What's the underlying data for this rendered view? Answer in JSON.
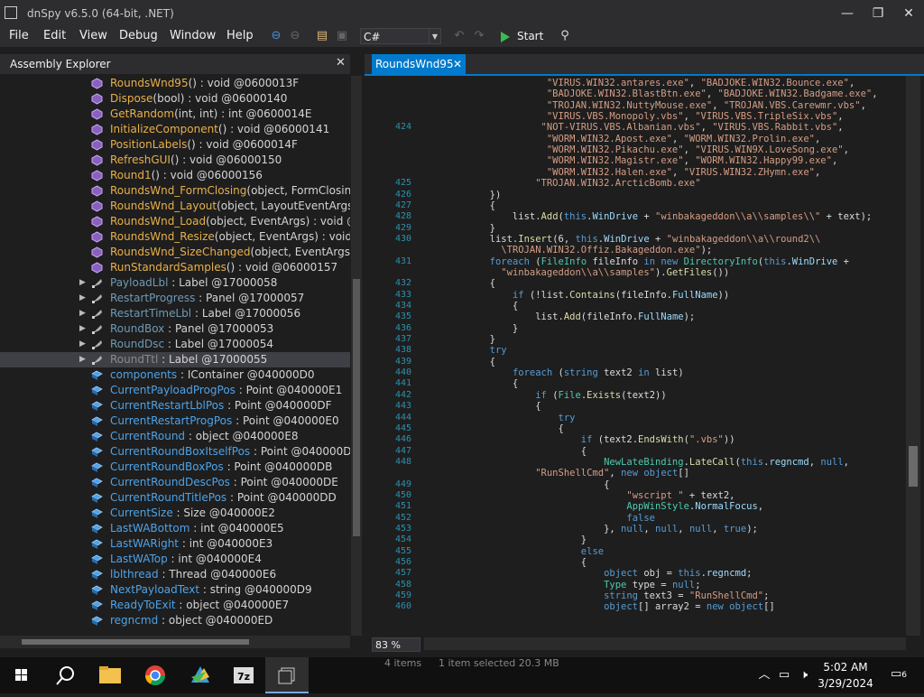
{
  "window": {
    "title": "dnSpy v6.5.0 (64-bit, .NET)",
    "minimize": "—",
    "maximize": "❐",
    "close": "✕"
  },
  "menu": [
    "File",
    "Edit",
    "View",
    "Debug",
    "Window",
    "Help"
  ],
  "toolbar": {
    "language": "C#",
    "start_label": "Start"
  },
  "assembly_explorer": {
    "title": "Assembly Explorer",
    "items": [
      {
        "name": "RoundsWnd95",
        "sig": "() : void @0600013F",
        "kind": "method"
      },
      {
        "name": "Dispose",
        "sig": "(bool) : void @06000140",
        "kind": "method"
      },
      {
        "name": "GetRandom",
        "sig": "(int, int) : int @0600014E",
        "kind": "method"
      },
      {
        "name": "InitializeComponent",
        "sig": "() : void @06000141",
        "kind": "method"
      },
      {
        "name": "PositionLabels",
        "sig": "() : void @0600014F",
        "kind": "method"
      },
      {
        "name": "RefreshGUI",
        "sig": "() : void @06000150",
        "kind": "method"
      },
      {
        "name": "Round1",
        "sig": "() : void @06000156",
        "kind": "method"
      },
      {
        "name": "RoundsWnd_FormClosing",
        "sig": "(object, FormClosingEve",
        "kind": "method"
      },
      {
        "name": "RoundsWnd_Layout",
        "sig": "(object, LayoutEventArgs) : vo",
        "kind": "method"
      },
      {
        "name": "RoundsWnd_Load",
        "sig": "(object, EventArgs) : void @0600",
        "kind": "method"
      },
      {
        "name": "RoundsWnd_Resize",
        "sig": "(object, EventArgs) : void @060",
        "kind": "method"
      },
      {
        "name": "RoundsWnd_SizeChanged",
        "sig": "(object, EventArgs) : voi",
        "kind": "method"
      },
      {
        "name": "RunStandardSamples",
        "sig": "() : void @06000157",
        "kind": "method"
      },
      {
        "name": "PayloadLbl",
        "sig": " : Label @17000058",
        "kind": "prop"
      },
      {
        "name": "RestartProgress",
        "sig": " : Panel @17000057",
        "kind": "prop"
      },
      {
        "name": "RestartTimeLbl",
        "sig": " : Label @17000056",
        "kind": "prop"
      },
      {
        "name": "RoundBox",
        "sig": " : Panel @17000053",
        "kind": "prop"
      },
      {
        "name": "RoundDsc",
        "sig": " : Label @17000054",
        "kind": "prop"
      },
      {
        "name": "RoundTtl",
        "sig": " : Label @17000055",
        "kind": "prop"
      },
      {
        "name": "components",
        "sig": " : IContainer @040000D0",
        "kind": "field"
      },
      {
        "name": "CurrentPayloadProgPos",
        "sig": " : Point @040000E1",
        "kind": "field"
      },
      {
        "name": "CurrentRestartLblPos",
        "sig": " : Point @040000DF",
        "kind": "field"
      },
      {
        "name": "CurrentRestartProgPos",
        "sig": " : Point @040000E0",
        "kind": "field"
      },
      {
        "name": "CurrentRound",
        "sig": " : object @040000E8",
        "kind": "field"
      },
      {
        "name": "CurrentRoundBoxItselfPos",
        "sig": " : Point @040000DC",
        "kind": "field"
      },
      {
        "name": "CurrentRoundBoxPos",
        "sig": " : Point @040000DB",
        "kind": "field"
      },
      {
        "name": "CurrentRoundDescPos",
        "sig": " : Point @040000DE",
        "kind": "field"
      },
      {
        "name": "CurrentRoundTitlePos",
        "sig": " : Point @040000DD",
        "kind": "field"
      },
      {
        "name": "CurrentSize",
        "sig": " : Size @040000E2",
        "kind": "field"
      },
      {
        "name": "LastWABottom",
        "sig": " : int @040000E5",
        "kind": "field"
      },
      {
        "name": "LastWARight",
        "sig": " : int @040000E3",
        "kind": "field"
      },
      {
        "name": "LastWATop",
        "sig": " : int @040000E4",
        "kind": "field"
      },
      {
        "name": "lblthread",
        "sig": " : Thread @040000E6",
        "kind": "field"
      },
      {
        "name": "NextPayloadText",
        "sig": " : string @040000D9",
        "kind": "field"
      },
      {
        "name": "ReadyToExit",
        "sig": " : object @040000E7",
        "kind": "field"
      },
      {
        "name": "regncmd",
        "sig": " : object @040000ED",
        "kind": "field"
      }
    ],
    "selected_index": 18
  },
  "editor": {
    "tab_label": "RoundsWnd95",
    "zoom": "83 %",
    "lines": [
      {
        "n": "",
        "h": "            <span class=\"s\">\"VIRUS.WIN32.antares.exe\"</span>, <span class=\"s\">\"BADJOKE.WIN32.Bounce.exe\"</span>,"
      },
      {
        "n": "",
        "h": "            <span class=\"s\">\"BADJOKE.WIN32.BlastBtn.exe\"</span>, <span class=\"s\">\"BADJOKE.WIN32.Badgame.exe\"</span>,"
      },
      {
        "n": "",
        "h": "            <span class=\"s\">\"TROJAN.WIN32.NuttyMouse.exe\"</span>, <span class=\"s\">\"TROJAN.VBS.Carewmr.vbs\"</span>,"
      },
      {
        "n": "",
        "h": "            <span class=\"s\">\"VIRUS.VBS.Monopoly.vbs\"</span>, <span class=\"s\">\"VIRUS.VBS.TripleSix.vbs\"</span>,"
      },
      {
        "n": "424",
        "h": "           <span class=\"s\">\"NOT-VIRUS.VBS.Albanian.vbs\"</span>, <span class=\"s\">\"VIRUS.VBS.Rabbit.vbs\"</span>,"
      },
      {
        "n": "",
        "h": "            <span class=\"s\">\"WORM.WIN32.Apost.exe\"</span>, <span class=\"s\">\"WORM.WIN32.Prolin.exe\"</span>,"
      },
      {
        "n": "",
        "h": "            <span class=\"s\">\"WORM.WIN32.Pikachu.exe\"</span>, <span class=\"s\">\"VIRUS.WIN9X.LoveSong.exe\"</span>,"
      },
      {
        "n": "",
        "h": "            <span class=\"s\">\"WORM.WIN32.Magistr.exe\"</span>, <span class=\"s\">\"WORM.WIN32.Happy99.exe\"</span>,"
      },
      {
        "n": "",
        "h": "            <span class=\"s\">\"WORM.WIN32.Halen.exe\"</span>, <span class=\"s\">\"VIRUS.WIN32.ZHymn.exe\"</span>,"
      },
      {
        "n": "425",
        "h": "          <span class=\"s\">\"TROJAN.WIN32.ArcticBomb.exe\"</span>"
      },
      {
        "n": "426",
        "h": "  })"
      },
      {
        "n": "427",
        "h": "  {"
      },
      {
        "n": "428",
        "h": "      list.<span class=\"m\">Add</span>(<span class=\"k\">this</span>.<span class=\"p\">WinDrive</span> + <span class=\"s\">\"winbakageddon\\\\a\\\\samples\\\\\"</span> + text);"
      },
      {
        "n": "429",
        "h": "  }"
      },
      {
        "n": "430",
        "h": "  list.<span class=\"m\">Insert</span>(6, <span class=\"k\">this</span>.<span class=\"p\">WinDrive</span> + <span class=\"s\">\"winbakageddon\\\\a\\\\round2\\\\</span>"
      },
      {
        "n": "",
        "h": "    <span class=\"s\">\\TROJAN.WIN32.Offiz.Bakageddon.exe\"</span>);"
      },
      {
        "n": "431",
        "h": "  <span class=\"k\">foreach</span> (<span class=\"t\">FileInfo</span> fileInfo <span class=\"k\">in new</span> <span class=\"t\">DirectoryInfo</span>(<span class=\"k\">this</span>.<span class=\"p\">WinDrive</span> +"
      },
      {
        "n": "",
        "h": "    <span class=\"s\">\"winbakageddon\\\\a\\\\samples\"</span>).<span class=\"m\">GetFiles</span>())"
      },
      {
        "n": "432",
        "h": "  {"
      },
      {
        "n": "433",
        "h": "      <span class=\"k\">if</span> (!list.<span class=\"m\">Contains</span>(fileInfo.<span class=\"p\">FullName</span>))"
      },
      {
        "n": "434",
        "h": "      {"
      },
      {
        "n": "435",
        "h": "          list.<span class=\"m\">Add</span>(fileInfo.<span class=\"p\">FullName</span>);"
      },
      {
        "n": "436",
        "h": "      }"
      },
      {
        "n": "437",
        "h": "  }"
      },
      {
        "n": "438",
        "h": "  <span class=\"k\">try</span>"
      },
      {
        "n": "439",
        "h": "  {"
      },
      {
        "n": "440",
        "h": "      <span class=\"k\">foreach</span> (<span class=\"k\">string</span> text2 <span class=\"k\">in</span> list)"
      },
      {
        "n": "441",
        "h": "      {"
      },
      {
        "n": "442",
        "h": "          <span class=\"k\">if</span> (<span class=\"t\">File</span>.<span class=\"m\">Exists</span>(text2))"
      },
      {
        "n": "443",
        "h": "          {"
      },
      {
        "n": "444",
        "h": "              <span class=\"k\">try</span>"
      },
      {
        "n": "445",
        "h": "              {"
      },
      {
        "n": "446",
        "h": "                  <span class=\"k\">if</span> (text2.<span class=\"m\">EndsWith</span>(<span class=\"s\">\".vbs\"</span>))"
      },
      {
        "n": "447",
        "h": "                  {"
      },
      {
        "n": "448",
        "h": "                      <span class=\"t\">NewLateBinding</span>.<span class=\"m\">LateCall</span>(<span class=\"k\">this</span>.<span class=\"p\">regncmd</span>, <span class=\"k\">null</span>,"
      },
      {
        "n": "",
        "h": "          <span class=\"s\">\"RunShellCmd\"</span>, <span class=\"k\">new</span> <span class=\"k\">object</span>[]"
      },
      {
        "n": "449",
        "h": "                      {"
      },
      {
        "n": "450",
        "h": "                          <span class=\"s\">\"wscript \"</span> + text2,"
      },
      {
        "n": "451",
        "h": "                          <span class=\"t\">AppWinStyle</span>.<span class=\"p\">NormalFocus</span>,"
      },
      {
        "n": "452",
        "h": "                          <span class=\"k\">false</span>"
      },
      {
        "n": "453",
        "h": "                      }, <span class=\"k\">null</span>, <span class=\"k\">null</span>, <span class=\"k\">null</span>, <span class=\"k\">true</span>);"
      },
      {
        "n": "454",
        "h": "                  }"
      },
      {
        "n": "455",
        "h": "                  <span class=\"k\">else</span>"
      },
      {
        "n": "456",
        "h": "                  {"
      },
      {
        "n": "457",
        "h": "                      <span class=\"k\">object</span> obj = <span class=\"k\">this</span>.<span class=\"p\">regncmd</span>;"
      },
      {
        "n": "458",
        "h": "                      <span class=\"t\">Type</span> type = <span class=\"k\">null</span>;"
      },
      {
        "n": "459",
        "h": "                      <span class=\"k\">string</span> text3 = <span class=\"s\">\"RunShellCmd\"</span>;"
      },
      {
        "n": "460",
        "h": "                      <span class=\"k\">object</span>[] array2 = <span class=\"k\">new object</span>[]"
      }
    ]
  },
  "status": {
    "items": "4 items",
    "selected": "1 item selected  20.3 MB"
  },
  "taskbar": {
    "time": "5:02 AM",
    "date": "3/29/2024",
    "notifications": "6"
  },
  "colors": {
    "accent": "#007acc",
    "method": "#e8a33d",
    "property": "#c0a060",
    "field": "#4ea3e8"
  }
}
